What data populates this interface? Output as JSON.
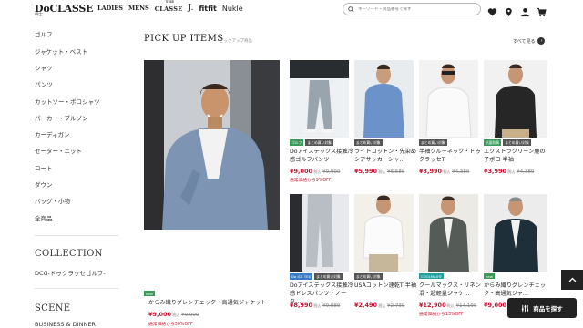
{
  "header": {
    "logo": "DoCLASSE",
    "nav": {
      "ladies": "LADIES",
      "mens": "MENS",
      "classe_small": "THE",
      "classe": "CLASSE",
      "j": "J.",
      "fitfit": "fitfit",
      "nukle": "Nukle"
    },
    "search_placeholder": "キーワード・商品番号で探す"
  },
  "sidebar": {
    "top_cut": "紳士",
    "categories": [
      "ゴルフ",
      "ジャケット・ベスト",
      "シャツ",
      "パンツ",
      "カットソー・ポロシャツ",
      "パーカー・ブルゾン",
      "カーディガン",
      "セーター・ニット",
      "コート",
      "ダウン",
      "バッグ・小物",
      "全商品"
    ],
    "collection_title": "COLLECTION",
    "collection_item": "DCG-ドゥクラッセゴルフ-",
    "scene_title": "SCENE",
    "scene_item": "BUSINESS & DINNER"
  },
  "main": {
    "title": "PICK UP ITEMS",
    "subtitle": "ピックアップ商品",
    "see_all": "すべて見る"
  },
  "products": [
    {
      "name": "からみ織りグレンチェック・高通気ジャケット",
      "tags": [
        {
          "t": "new",
          "c": "green"
        }
      ],
      "price": "¥9,000",
      "inc": "税込",
      "old": "¥9,900",
      "note": "通常価格から30%OFF"
    },
    {
      "name": "Doアイステックス接触冷感ゴルフパンツ",
      "tags": [
        {
          "t": "ゴルフ",
          "c": "green"
        },
        {
          "t": "まとめ買い対象",
          "c": "dark"
        }
      ],
      "price": "¥9,000",
      "inc": "税込",
      "old": "¥9,900",
      "note": "通常価格から9%OFF"
    },
    {
      "name": "ライトコットン・先染めシアサッカーシャ…",
      "tags": [
        {
          "t": "まとめ買い対象",
          "c": "dark"
        }
      ],
      "price": "¥5,990",
      "inc": "税込",
      "old": "¥6,589",
      "note": ""
    },
    {
      "name": "半袖クルーネック・ドゥクラッセT",
      "tags": [
        {
          "t": "まとめ買い対象",
          "c": "dark"
        }
      ],
      "price": "¥3,990",
      "inc": "税込",
      "old": "¥4,389",
      "note": ""
    },
    {
      "name": "エクストラクリーン鹿の子ポロ 半袖",
      "tags": [
        {
          "t": "抗菌防臭",
          "c": "green"
        },
        {
          "t": "まとめ買い対象",
          "c": "dark"
        }
      ],
      "price": "¥3,990",
      "inc": "税込",
      "old": "¥4,389",
      "note": ""
    },
    {
      "name": "Doアイステックス接触冷感ドレスパンツ・ノータ…",
      "tags": [
        {
          "t": "Do ICE TEX",
          "c": "blue"
        },
        {
          "t": "まとめ買い対象",
          "c": "dark"
        }
      ],
      "price": "¥8,990",
      "inc": "税込",
      "old": "¥9,889",
      "note": ""
    },
    {
      "name": "USAコットン速乾T 半袖",
      "tags": [
        {
          "t": "まとめ買い対象",
          "c": "dark"
        }
      ],
      "price": "¥2,490",
      "inc": "税込",
      "old": "¥2,739",
      "note": ""
    },
    {
      "name": "クールマックス・リネン混・超軽量ジャケ…",
      "tags": [
        {
          "t": "COOLMAX®",
          "c": "teal"
        }
      ],
      "price": "¥12,900",
      "inc": "税込",
      "old": "¥14,190",
      "note": "通常価格から13%OFF"
    },
    {
      "name": "からみ織りグレンチェック・高通気ジャ…",
      "tags": [
        {
          "t": "new",
          "c": "green"
        }
      ],
      "price": "¥9,000",
      "inc": "",
      "old": "",
      "note": ""
    }
  ],
  "footer": {
    "find_button": "商品を探す"
  },
  "colors": {
    "sale": "#c8102e",
    "tag_green": "#3a9a5a",
    "dark": "#222222"
  }
}
